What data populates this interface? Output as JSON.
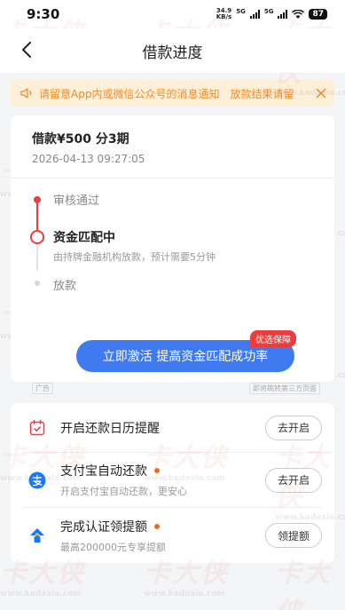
{
  "status_bar": {
    "time": "9:30",
    "network_speed_value": "34.9",
    "network_speed_unit": "KB/s",
    "signal_label_1": "5G",
    "signal_label_2": "5G",
    "battery": "87"
  },
  "header": {
    "title": "借款进度"
  },
  "notice": {
    "text": "请留意App内或微信公众号的消息通知　放款结果请留",
    "color": "#f08a24"
  },
  "loan": {
    "summary": "借款¥500  分3期",
    "date": "2026-04-13 09:27:05"
  },
  "timeline": {
    "steps": [
      {
        "label": "审核通过"
      },
      {
        "label": "资金匹配中",
        "sub": "由持牌金融机构放款，预计需要5分钟"
      },
      {
        "label": "放款"
      }
    ]
  },
  "boost": {
    "button_label": "立即激活 提高资金匹配成功率",
    "badge": "优选保障",
    "ad_label": "广告",
    "third_party_label": "即将跳转第三方页面"
  },
  "actions": [
    {
      "title": "开启还款日历提醒",
      "button": "去开启",
      "icon": "calendar-icon"
    },
    {
      "title": "支付宝自动还款",
      "sub": "开启支付宝自动还款，更安心",
      "button": "去开启",
      "icon": "alipay-icon"
    },
    {
      "title": "完成认证领提额",
      "sub": "最高200000元专享提额",
      "button": "领提额",
      "icon": "credit-boost-icon"
    }
  ],
  "watermark": {
    "brand": "卡大侠",
    "site": "www.kadaxia.com"
  },
  "colors": {
    "accent_blue": "#3f7af1",
    "progress_red": "#ee3b3b",
    "dot_orange": "#f26b1d"
  }
}
